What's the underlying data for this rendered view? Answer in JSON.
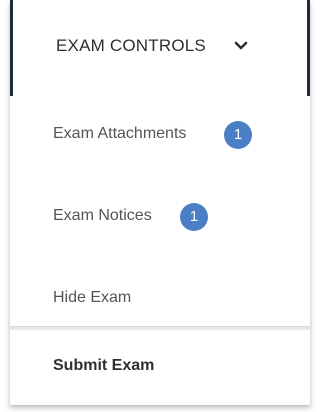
{
  "header": {
    "label": "EXAM CONTROLS",
    "icon": "chevron-down-icon"
  },
  "menu": {
    "items": [
      {
        "label": "Exam Attachments",
        "badge": "1"
      },
      {
        "label": "Exam Notices",
        "badge": "1"
      },
      {
        "label": "Hide Exam"
      }
    ],
    "submit_label": "Submit Exam"
  },
  "colors": {
    "badge": "#4a7fc6",
    "header_border": "#1b2a3d",
    "text_primary": "#2f2f2f",
    "text_secondary": "#555555"
  }
}
